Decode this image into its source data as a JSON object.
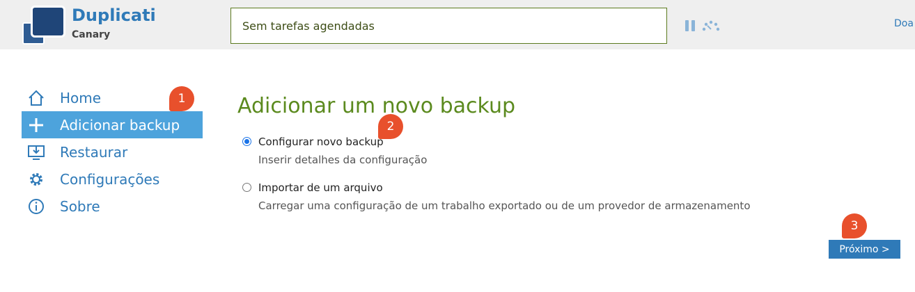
{
  "header": {
    "brand_name": "Duplicati",
    "brand_sub": "Canary",
    "status_text": "Sem tarefas agendadas",
    "donate_label": "Doa"
  },
  "nav": {
    "items": [
      {
        "label": "Home",
        "icon": "home-icon",
        "active": false
      },
      {
        "label": "Adicionar backup",
        "icon": "plus-icon",
        "active": true
      },
      {
        "label": "Restaurar",
        "icon": "restore-icon",
        "active": false
      },
      {
        "label": "Configurações",
        "icon": "gear-icon",
        "active": false
      },
      {
        "label": "Sobre",
        "icon": "info-icon",
        "active": false
      }
    ]
  },
  "main": {
    "title": "Adicionar um novo backup",
    "options": [
      {
        "title": "Configurar novo backup",
        "description": "Inserir detalhes da configuração",
        "selected": true
      },
      {
        "title": "Importar de um arquivo",
        "description": "Carregar uma configuração de um trabalho exportado ou de um provedor de armazenamento",
        "selected": false
      }
    ],
    "next_label": "Próximo >"
  },
  "markers": [
    "1",
    "2",
    "3"
  ],
  "colors": {
    "accent": "#2f7ab8",
    "active_nav": "#4da3dc",
    "title_green": "#5b8a1e",
    "marker": "#e8502c"
  }
}
